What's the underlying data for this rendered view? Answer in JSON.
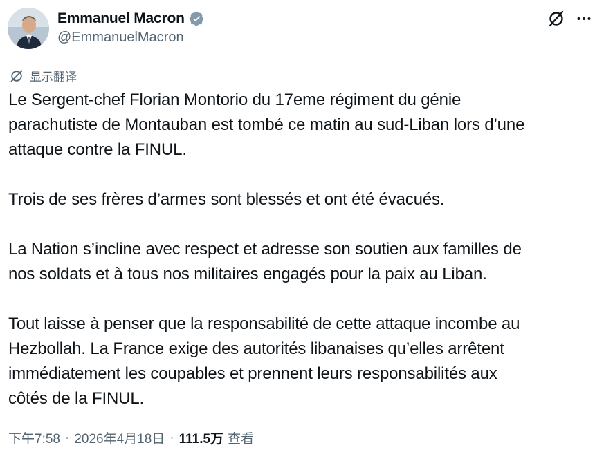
{
  "author": {
    "display_name": "Emmanuel Macron",
    "handle": "@EmmanuelMacron",
    "verified": true,
    "verified_color": "#1d9bf0"
  },
  "actions": {
    "grok_icon": "grok-icon",
    "more_icon": "more-icon"
  },
  "translate": {
    "label": "显示翻译"
  },
  "tweet": {
    "paragraphs": [
      [
        "Le Sergent-chef Florian Montorio du 17eme régiment du génie",
        "parachutiste de Montauban est tombé ce matin au sud-Liban lors d’une",
        "attaque contre la FINUL."
      ],
      [
        "Trois de ses frères d’armes sont blessés et ont été évacués."
      ],
      [
        "La Nation s’incline avec respect et adresse son soutien aux familles de",
        "nos soldats et à tous nos militaires engagés pour la paix au Liban."
      ],
      [
        "Tout laisse à penser que la responsabilité de cette attaque incombe au",
        "Hezbollah. La France exige des autorités libanaises qu’elles arrêtent",
        "immédiatement les coupables et prennent leurs responsabilités aux",
        "côtés de la FINUL."
      ]
    ]
  },
  "meta": {
    "time": "下午7:58",
    "separator": "·",
    "date": "2026年4月18日",
    "views_count": "111.5万",
    "views_label": "查看"
  }
}
